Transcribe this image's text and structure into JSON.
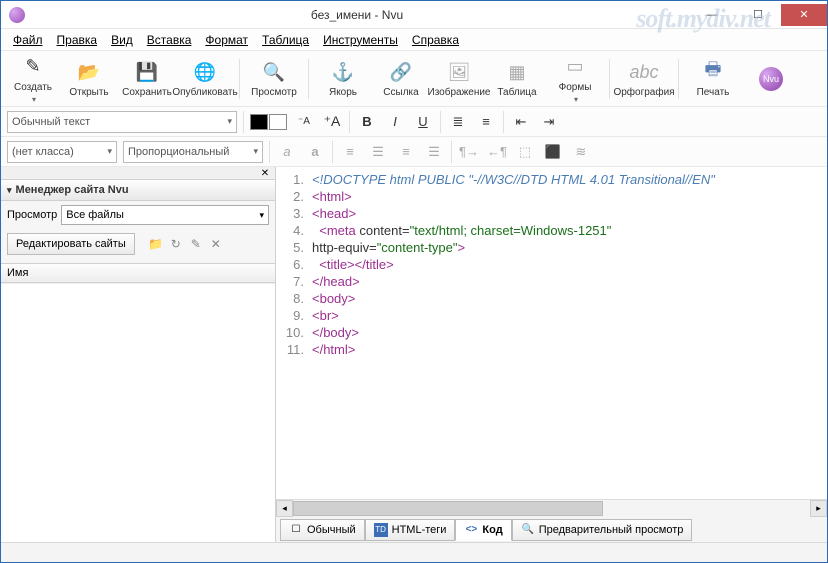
{
  "window": {
    "title": "без_имени - Nvu"
  },
  "watermark": "soft.mydiv.net",
  "menu": [
    "Файл",
    "Правка",
    "Вид",
    "Вставка",
    "Формат",
    "Таблица",
    "Инструменты",
    "Справка"
  ],
  "toolbar": {
    "create": "Создать",
    "open": "Открыть",
    "save": "Сохранить",
    "publish": "Опубликовать",
    "preview": "Просмотр",
    "anchor": "Якорь",
    "link": "Ссылка",
    "image": "Изображение",
    "table": "Таблица",
    "forms": "Формы",
    "spell": "Орфография",
    "print": "Печать"
  },
  "format_row": {
    "paragraph_style": "Обычный текст",
    "color_fg": "#000000",
    "color_bg": "#ffffff"
  },
  "class_row": {
    "class_combo": "(нет класса)",
    "font_combo": "Пропорциональный"
  },
  "sidebar": {
    "title": "Менеджер сайта Nvu",
    "view_label": "Просмотр",
    "view_value": "Все файлы",
    "edit_btn": "Редактировать сайты",
    "list_header": "Имя"
  },
  "code": {
    "lines": [
      {
        "n": "1.",
        "type": "doctype",
        "text": "<!DOCTYPE html PUBLIC \"-//W3C//DTD HTML 4.01 Transitional//EN\""
      },
      {
        "n": "2.",
        "type": "tag",
        "text": "<html>"
      },
      {
        "n": "3.",
        "type": "tag",
        "text": "<head>"
      },
      {
        "n": "4.",
        "type": "meta",
        "indent": "  ",
        "tag_open": "<meta ",
        "attr": "content=",
        "val": "\"text/html; charset=Windows-1251\""
      },
      {
        "n": "5.",
        "type": "meta2",
        "attr": "http-equiv=",
        "val": "\"content-type\"",
        "close": ">"
      },
      {
        "n": "6.",
        "type": "tag",
        "indent": "  ",
        "text": "<title></title>"
      },
      {
        "n": "7.",
        "type": "tag",
        "text": "</head>"
      },
      {
        "n": "8.",
        "type": "tag",
        "text": "<body>"
      },
      {
        "n": "9.",
        "type": "tag",
        "text": "<br>"
      },
      {
        "n": "10.",
        "type": "tag",
        "text": "</body>"
      },
      {
        "n": "11.",
        "type": "tag",
        "text": "</html>"
      }
    ]
  },
  "tabs": {
    "normal": "Обычный",
    "html": "HTML-теги",
    "code": "Код",
    "preview": "Предварительный просмотр"
  }
}
